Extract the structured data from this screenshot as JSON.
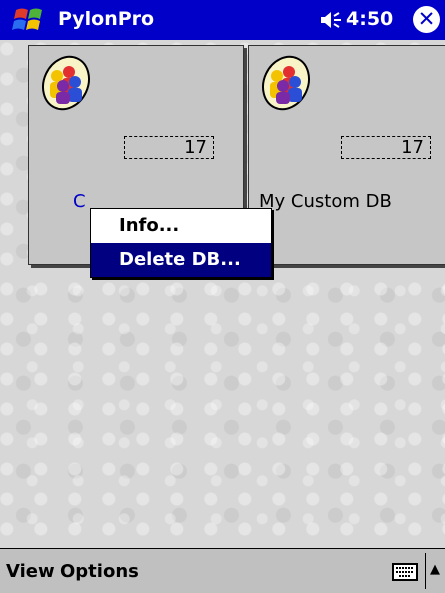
{
  "titlebar": {
    "app_title": "PylonPro",
    "time": "4:50",
    "close_label": "✕"
  },
  "tiles": [
    {
      "count": "17",
      "name": "C"
    },
    {
      "count": "17",
      "name": "My Custom DB"
    }
  ],
  "context_menu": {
    "items": [
      "Info...",
      "Delete DB..."
    ],
    "selected_index": 1
  },
  "menubar": {
    "view": "View",
    "options": "Options",
    "sip_arrow": "▲"
  },
  "colors": {
    "titlebar": "#0000c8",
    "selection": "#000080",
    "background": "#d7d7d7"
  }
}
